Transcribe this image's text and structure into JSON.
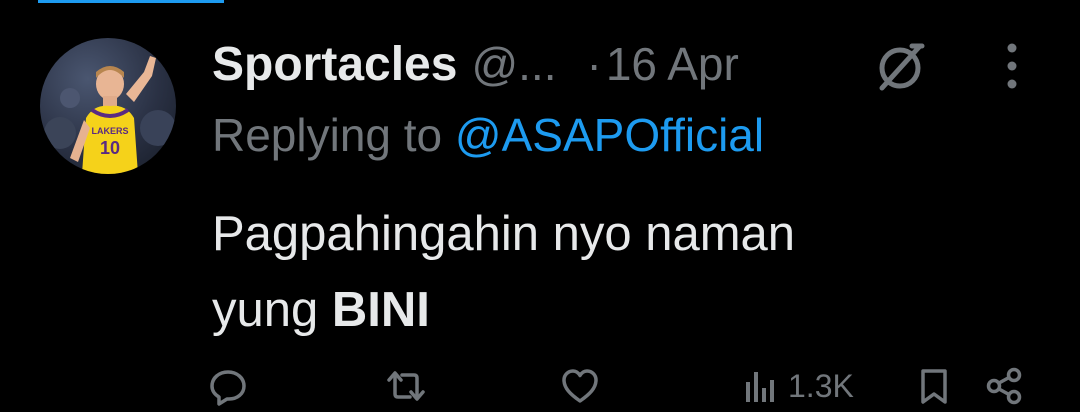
{
  "tweet": {
    "author_name": "Sportacles",
    "author_handle": "@...",
    "dot": "·",
    "date": "16 Apr",
    "replying_prefix": "Replying to ",
    "replying_to": "@ASAPOfficial",
    "text_line1": "Pagpahingahin nyo naman",
    "text_line2_plain": "yung ",
    "text_line2_bold": "BINI"
  },
  "actions": {
    "views": "1.3K"
  },
  "avatar": {
    "jersey_number": "10"
  },
  "colors": {
    "background": "#000000",
    "text_primary": "#e7e9ea",
    "text_secondary": "#71767b",
    "link": "#1d9bf0",
    "jersey": "#f5d21a"
  },
  "icons": [
    "grok-icon",
    "more-icon",
    "reply-icon",
    "retweet-icon",
    "like-icon",
    "views-icon",
    "bookmark-icon",
    "share-icon"
  ]
}
